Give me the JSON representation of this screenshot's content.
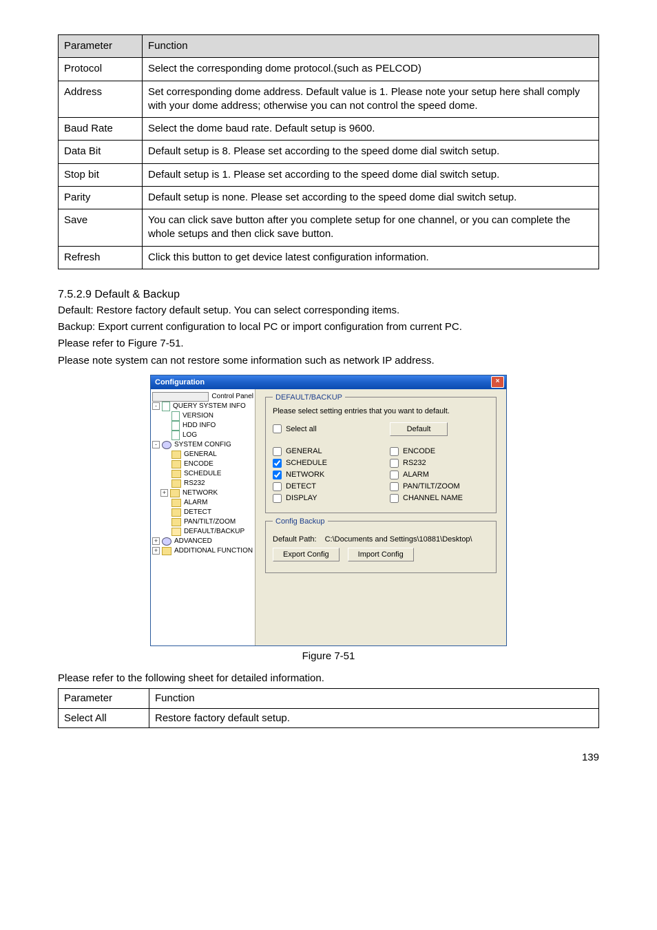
{
  "table1": {
    "header": {
      "param": "Parameter",
      "func": "Function"
    },
    "rows": [
      {
        "param": "Protocol",
        "func": "Select the corresponding dome protocol.(such as PELCOD)"
      },
      {
        "param": "Address",
        "func": "Set corresponding dome address. Default value is 1. Please note your setup here shall comply with your dome address; otherwise you can not control the speed dome."
      },
      {
        "param": "Baud Rate",
        "func": "Select the dome baud rate. Default setup is 9600."
      },
      {
        "param": "Data Bit",
        "func": "Default setup is 8. Please set according to the speed dome dial switch setup."
      },
      {
        "param": "Stop bit",
        "func": "Default setup is 1. Please set according to the speed dome dial switch setup."
      },
      {
        "param": "Parity",
        "func": "Default setup is none. Please set according to the speed dome dial switch setup."
      },
      {
        "param": "Save",
        "func": "You can click save button after you complete setup for one channel, or you can complete the whole setups and then click save button."
      },
      {
        "param": "Refresh",
        "func": "Click this button to get device latest configuration information."
      }
    ]
  },
  "section": {
    "heading": "7.5.2.9  Default & Backup",
    "p1": "Default: Restore factory default setup. You can select corresponding items.",
    "p2": "Backup: Export current configuration to local PC or import configuration from current PC.",
    "p3": "Please refer to Figure 7-51.",
    "p4": "Please note system can not restore some information such as network IP address."
  },
  "window": {
    "title": "Configuration",
    "tree": {
      "control_panel": "Control Panel",
      "query": "QUERY SYSTEM INFO",
      "version": "VERSION",
      "hdd_info": "HDD INFO",
      "log": "LOG",
      "system_config": "SYSTEM CONFIG",
      "general": "GENERAL",
      "encode": "ENCODE",
      "schedule": "SCHEDULE",
      "rs232": "RS232",
      "network": "NETWORK",
      "alarm": "ALARM",
      "detect": "DETECT",
      "ptz": "PAN/TILT/ZOOM",
      "default_backup": "DEFAULT/BACKUP",
      "advanced": "ADVANCED",
      "additional": "ADDITIONAL FUNCTION"
    },
    "panel": {
      "fs1_legend": "DEFAULT/BACKUP",
      "prompt": "Please select setting entries that you want to default.",
      "select_all": "Select all",
      "default_btn": "Default",
      "chk_general": "GENERAL",
      "chk_encode": "ENCODE",
      "chk_schedule": "SCHEDULE",
      "chk_rs232": "RS232",
      "chk_network": "NETWORK",
      "chk_alarm": "ALARM",
      "chk_detect": "DETECT",
      "chk_ptz": "PAN/TILT/ZOOM",
      "chk_display": "DISPLAY",
      "chk_chname": "CHANNEL NAME",
      "fs2_legend": "Config Backup",
      "path_label": "Default Path:",
      "path_value": "C:\\Documents and Settings\\10881\\Desktop\\",
      "export_btn": "Export Config",
      "import_btn": "Import Config"
    }
  },
  "figure_caption": "Figure 7-51",
  "intro2": "Please refer to the following sheet for detailed information.",
  "table2": {
    "header": {
      "param": "Parameter",
      "func": "Function"
    },
    "rows": [
      {
        "param": "Select All",
        "func": "Restore factory default setup."
      }
    ]
  },
  "page_num": "139"
}
